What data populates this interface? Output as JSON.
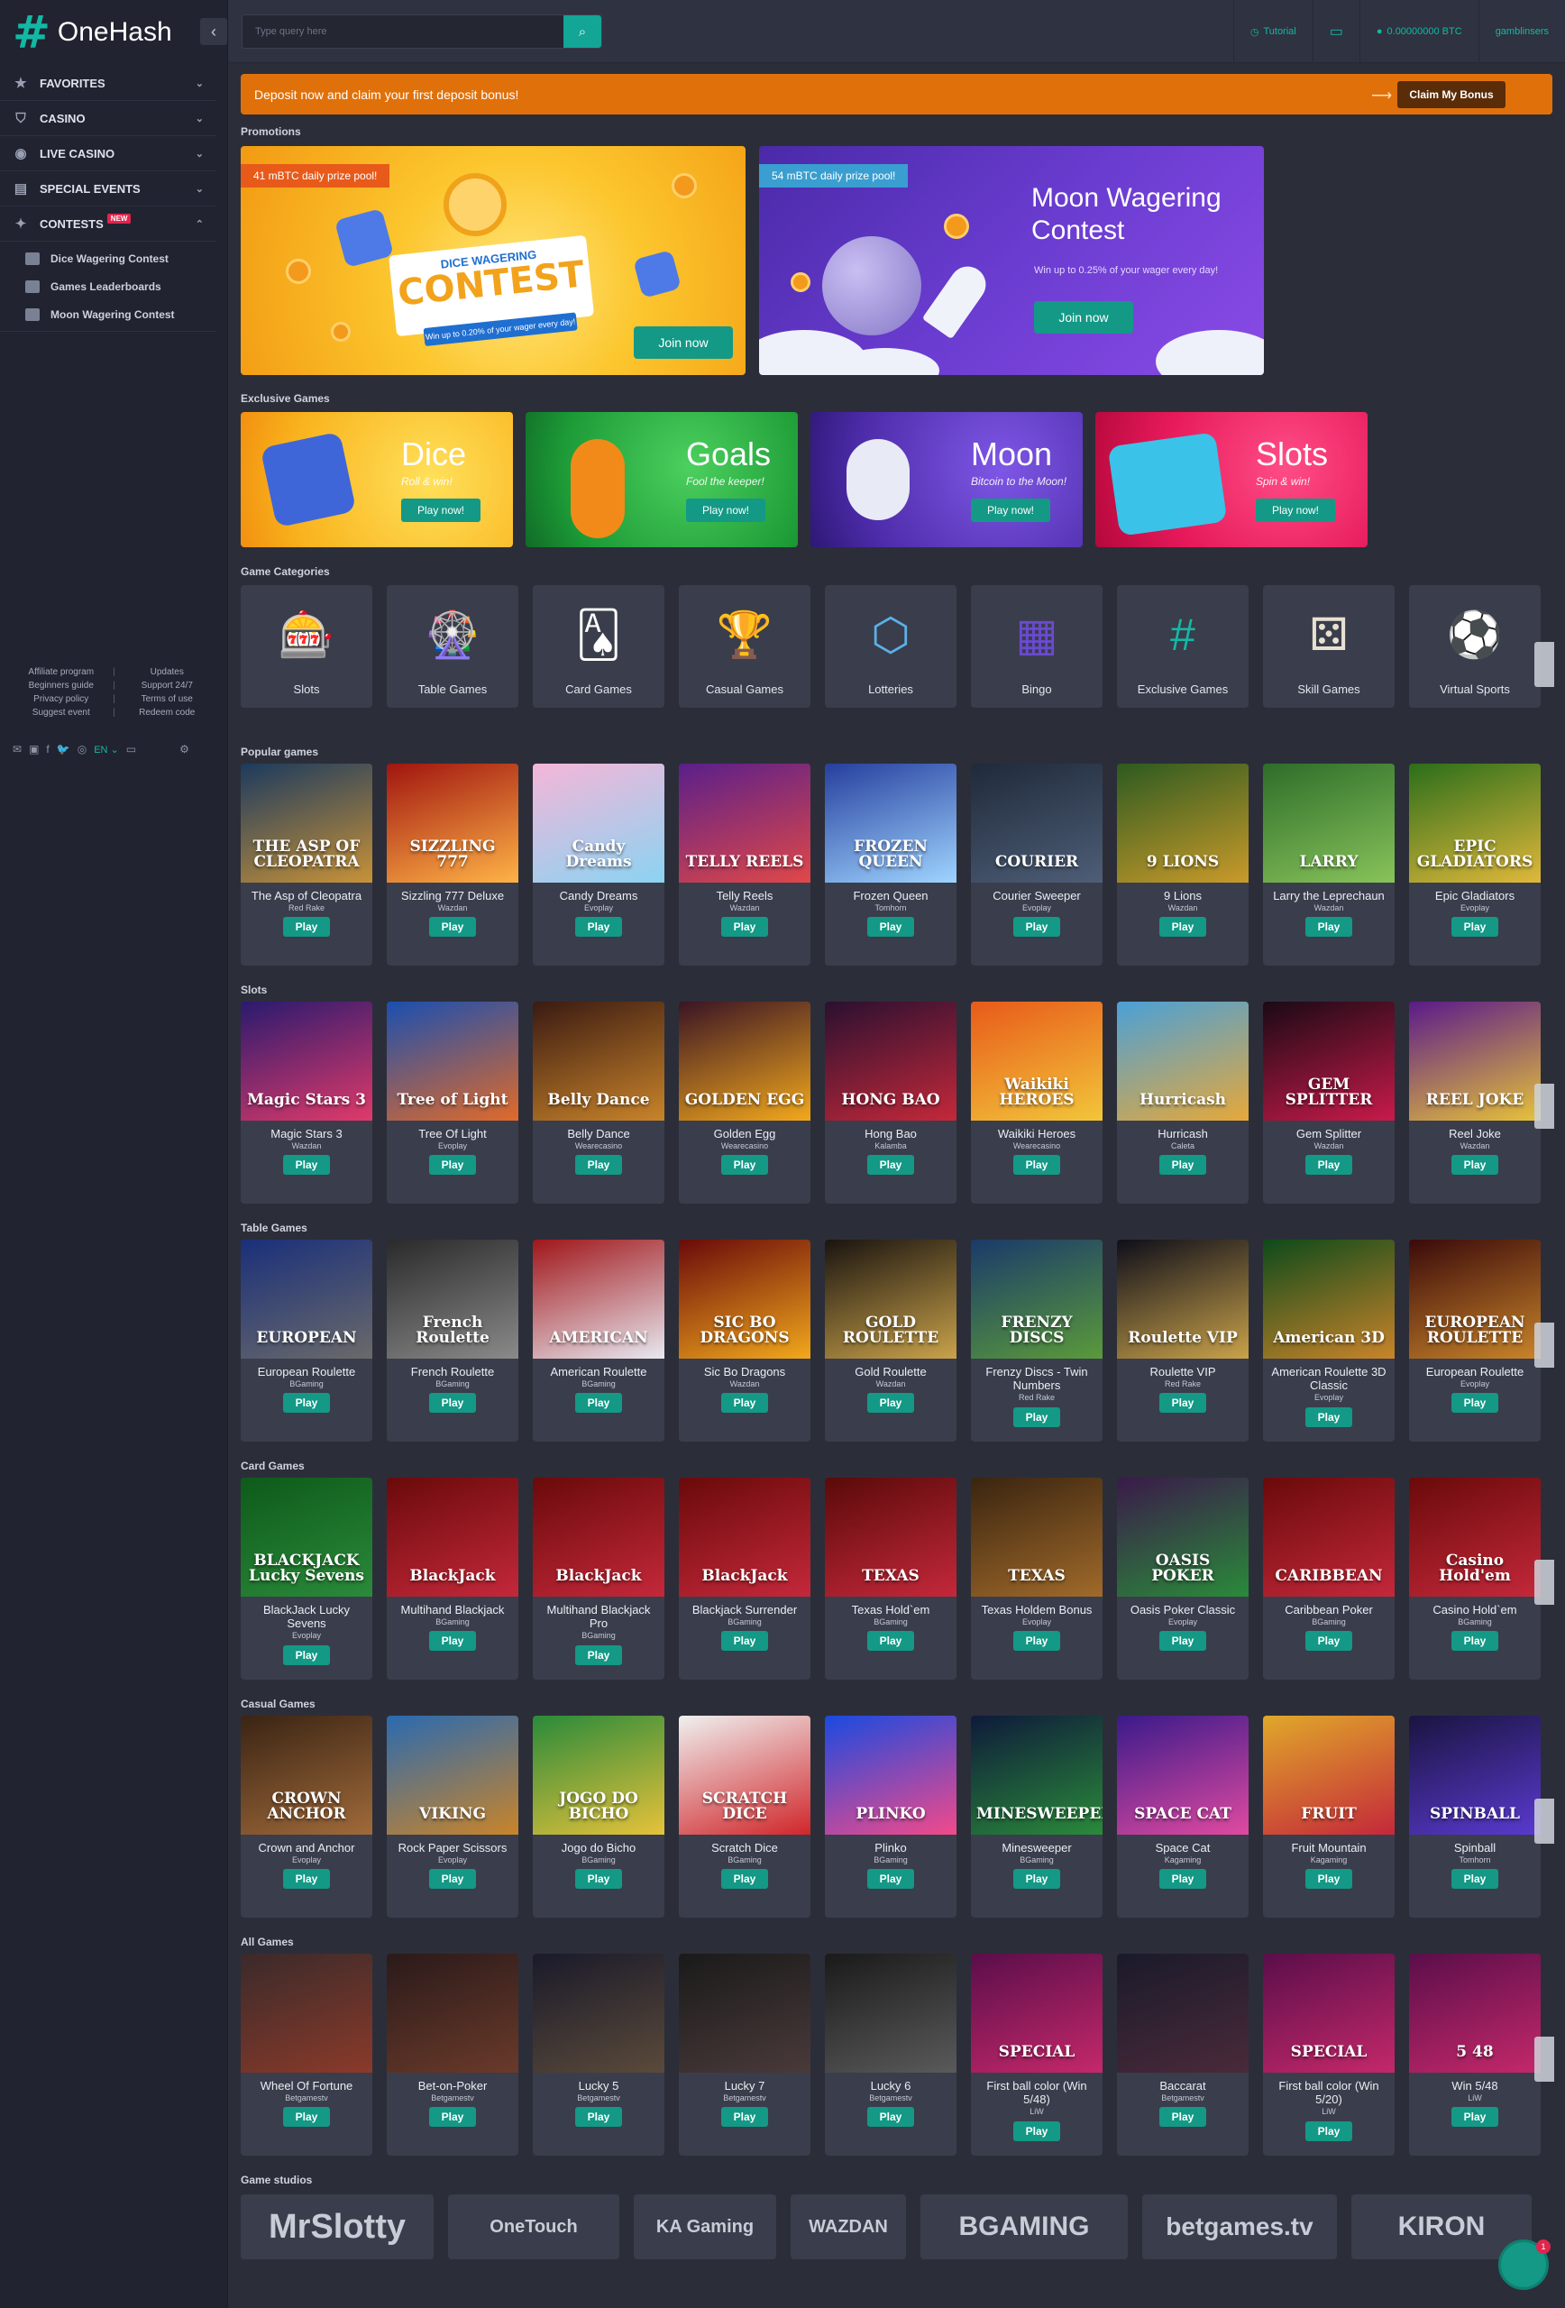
{
  "brand": {
    "name": "OneHash",
    "mark": "#",
    "accent": "#13b8a4"
  },
  "sidebar": {
    "items": [
      {
        "label": "FAVORITES",
        "icon": "star-icon"
      },
      {
        "label": "CASINO",
        "icon": "shield-icon"
      },
      {
        "label": "LIVE CASINO",
        "icon": "live-icon"
      },
      {
        "label": "SPECIAL EVENTS",
        "icon": "calendar-icon"
      },
      {
        "label": "CONTESTS",
        "icon": "sparkle-icon",
        "badge": "NEW"
      }
    ],
    "contests_sub": [
      "Dice Wagering Contest",
      "Games Leaderboards",
      "Moon Wagering Contest"
    ],
    "footer_links": [
      [
        "Affiliate program",
        "Updates"
      ],
      [
        "Beginners guide",
        "Support 24/7"
      ],
      [
        "Privacy policy",
        "Terms of use"
      ],
      [
        "Suggest event",
        "Redeem code"
      ]
    ],
    "language": "EN"
  },
  "topbar": {
    "search_placeholder": "Type query here",
    "tutorial": "Tutorial",
    "balance": "0.00000000 BTC",
    "username": "gamblinsers"
  },
  "bonus_bar": {
    "text": "Deposit now and claim your first deposit bonus!",
    "button": "Claim My Bonus"
  },
  "sections": {
    "promotions": "Promotions",
    "exclusive": "Exclusive Games",
    "categories": "Game Categories",
    "popular": "Popular games",
    "slots": "Slots",
    "table": "Table Games",
    "card": "Card Games",
    "casual": "Casual Games",
    "all": "All Games",
    "studios": "Game studios"
  },
  "promotions": [
    {
      "tag": "41 mBTC daily prize pool!",
      "title_small": "DICE WAGERING",
      "title_big": "CONTEST",
      "ribbon": "Win up to 0.20% of your wager every day!",
      "button": "Join now"
    },
    {
      "tag": "54 mBTC daily prize pool!",
      "title": "Moon Wagering Contest",
      "subtitle": "Win up to 0.25% of your wager every day!",
      "button": "Join now"
    }
  ],
  "exclusive_games": [
    {
      "title": "Dice",
      "subtitle": "Roll & win!",
      "button": "Play now!"
    },
    {
      "title": "Goals",
      "subtitle": "Fool the keeper!",
      "button": "Play now!"
    },
    {
      "title": "Moon",
      "subtitle": "Bitcoin to the Moon!",
      "button": "Play now!"
    },
    {
      "title": "Slots",
      "subtitle": "Spin & win!",
      "button": "Play now!"
    }
  ],
  "categories": [
    {
      "label": "Slots",
      "icon": "slot-machine-icon",
      "glyph": "🎰"
    },
    {
      "label": "Table Games",
      "icon": "roulette-icon",
      "glyph": "🎡"
    },
    {
      "label": "Card Games",
      "icon": "cards-icon",
      "glyph": "🂡"
    },
    {
      "label": "Casual Games",
      "icon": "trophy-icon",
      "glyph": "🏆"
    },
    {
      "label": "Lotteries",
      "icon": "lottery-icon",
      "glyph": "⬡"
    },
    {
      "label": "Bingo",
      "icon": "bingo-icon",
      "glyph": "▦"
    },
    {
      "label": "Exclusive Games",
      "icon": "hash-icon",
      "glyph": "#"
    },
    {
      "label": "Skill Games",
      "icon": "domino-icon",
      "glyph": "⚄"
    },
    {
      "label": "Virtual Sports",
      "icon": "soccer-ball-icon",
      "glyph": "⚽"
    }
  ],
  "play_label": "Play",
  "rows": {
    "popular": [
      {
        "name": "The Asp of Cleopatra",
        "provider": "Red Rake",
        "art": "THE ASP OF CLEOPATRA",
        "c1": "#1c3a5e",
        "c2": "#c79238"
      },
      {
        "name": "Sizzling 777 Deluxe",
        "provider": "Wazdan",
        "art": "SIZZLING 777",
        "c1": "#a0150f",
        "c2": "#ffb347"
      },
      {
        "name": "Candy Dreams",
        "provider": "Evoplay",
        "art": "Candy Dreams",
        "c1": "#f5b6d8",
        "c2": "#8bd3f2"
      },
      {
        "name": "Telly Reels",
        "provider": "Wazdan",
        "art": "TELLY REELS",
        "c1": "#5a1f8a",
        "c2": "#e04848"
      },
      {
        "name": "Frozen Queen",
        "provider": "Tomhorn",
        "art": "FROZEN QUEEN",
        "c1": "#263f9e",
        "c2": "#9fd4ff"
      },
      {
        "name": "Courier Sweeper",
        "provider": "Evoplay",
        "art": "COURIER",
        "c1": "#1f2a3a",
        "c2": "#4e5e77"
      },
      {
        "name": "9 Lions",
        "provider": "Wazdan",
        "art": "9 LIONS",
        "c1": "#2d5a20",
        "c2": "#c99a2a"
      },
      {
        "name": "Larry the Leprechaun",
        "provider": "Wazdan",
        "art": "LARRY",
        "c1": "#2e6d2a",
        "c2": "#88c35a"
      },
      {
        "name": "Epic Gladiators",
        "provider": "Evoplay",
        "art": "EPIC GLADIATORS",
        "c1": "#2b6e1a",
        "c2": "#e0b83a"
      }
    ],
    "slots": [
      {
        "name": "Magic Stars 3",
        "provider": "Wazdan",
        "art": "Magic Stars 3",
        "c1": "#2a1a6e",
        "c2": "#e03a6a"
      },
      {
        "name": "Tree Of Light",
        "provider": "Evoplay",
        "art": "Tree of Light",
        "c1": "#1a4fb0",
        "c2": "#e06a2a"
      },
      {
        "name": "Belly Dance",
        "provider": "Wearecasino",
        "art": "Belly Dance",
        "c1": "#3a1a12",
        "c2": "#c9842a"
      },
      {
        "name": "Golden Egg",
        "provider": "Wearecasino",
        "art": "GOLDEN EGG",
        "c1": "#3a1424",
        "c2": "#f2a81c"
      },
      {
        "name": "Hong Bao",
        "provider": "Kalamba",
        "art": "HONG BAO",
        "c1": "#2a1030",
        "c2": "#c4283a"
      },
      {
        "name": "Waikiki Heroes",
        "provider": "Wearecasino",
        "art": "Waikiki HEROES",
        "c1": "#e85a1a",
        "c2": "#f2c63a"
      },
      {
        "name": "Hurricash",
        "provider": "Caleta",
        "art": "Hurricash",
        "c1": "#4aa0d8",
        "c2": "#e6a83a"
      },
      {
        "name": "Gem Splitter",
        "provider": "Wazdan",
        "art": "GEM SPLITTER",
        "c1": "#1a0a14",
        "c2": "#c81a4a"
      },
      {
        "name": "Reel Joke",
        "provider": "Wazdan",
        "art": "REEL JOKE",
        "c1": "#5a1a8a",
        "c2": "#e6c23a"
      }
    ],
    "table": [
      {
        "name": "European Roulette",
        "provider": "BGaming",
        "art": "EUROPEAN",
        "c1": "#1a2f7a",
        "c2": "#6a6a6a"
      },
      {
        "name": "French Roulette",
        "provider": "BGaming",
        "art": "French Roulette",
        "c1": "#2a2a2a",
        "c2": "#8a8a8a"
      },
      {
        "name": "American Roulette",
        "provider": "BGaming",
        "art": "AMERICAN",
        "c1": "#a0161a",
        "c2": "#e8e8f0"
      },
      {
        "name": "Sic Bo Dragons",
        "provider": "Wazdan",
        "art": "SIC BO DRAGONS",
        "c1": "#6a0a0a",
        "c2": "#f2a81c"
      },
      {
        "name": "Gold Roulette",
        "provider": "Wazdan",
        "art": "GOLD ROULETTE",
        "c1": "#1a1410",
        "c2": "#c9a24a"
      },
      {
        "name": "Frenzy Discs - Twin Numbers",
        "provider": "Red Rake",
        "art": "FRENZY DISCS",
        "c1": "#1a3a6a",
        "c2": "#5a9a3a"
      },
      {
        "name": "Roulette VIP",
        "provider": "Red Rake",
        "art": "Roulette VIP",
        "c1": "#0e0e1a",
        "c2": "#c9a24a"
      },
      {
        "name": "American Roulette 3D Classic",
        "provider": "Evoplay",
        "art": "American 3D",
        "c1": "#0e4a1a",
        "c2": "#c9842a"
      },
      {
        "name": "European Roulette",
        "provider": "Evoplay",
        "art": "EUROPEAN ROULETTE",
        "c1": "#3a0a0a",
        "c2": "#c9842a"
      }
    ],
    "card": [
      {
        "name": "BlackJack Lucky Sevens",
        "provider": "Evoplay",
        "art": "BLACKJACK Lucky Sevens",
        "c1": "#0e5a1a",
        "c2": "#2a8a3a"
      },
      {
        "name": "Multihand Blackjack",
        "provider": "BGaming",
        "art": "BlackJack",
        "c1": "#6a0a0a",
        "c2": "#c4283a"
      },
      {
        "name": "Multihand Blackjack Pro",
        "provider": "BGaming",
        "art": "BlackJack",
        "c1": "#6a0a0a",
        "c2": "#c4283a"
      },
      {
        "name": "Blackjack Surrender",
        "provider": "BGaming",
        "art": "BlackJack",
        "c1": "#6a0a0a",
        "c2": "#c4283a"
      },
      {
        "name": "Texas Hold`em",
        "provider": "BGaming",
        "art": "TEXAS",
        "c1": "#5a0a0a",
        "c2": "#c4283a"
      },
      {
        "name": "Texas Holdem Bonus",
        "provider": "Evoplay",
        "art": "TEXAS",
        "c1": "#3a2410",
        "c2": "#a06a2a"
      },
      {
        "name": "Oasis Poker Classic",
        "provider": "Evoplay",
        "art": "OASIS POKER",
        "c1": "#3a1a4a",
        "c2": "#2a8a3a"
      },
      {
        "name": "Caribbean Poker",
        "provider": "BGaming",
        "art": "CARIBBEAN",
        "c1": "#6a0a0a",
        "c2": "#c4283a"
      },
      {
        "name": "Casino Hold`em",
        "provider": "BGaming",
        "art": "Casino Hold'em",
        "c1": "#6a0a0a",
        "c2": "#c4283a"
      }
    ],
    "casual": [
      {
        "name": "Crown and Anchor",
        "provider": "Evoplay",
        "art": "CROWN ANCHOR",
        "c1": "#3a2414",
        "c2": "#a06a3a"
      },
      {
        "name": "Rock Paper Scissors",
        "provider": "Evoplay",
        "art": "VIKING",
        "c1": "#2a6ab0",
        "c2": "#c9842a"
      },
      {
        "name": "Jogo do Bicho",
        "provider": "BGaming",
        "art": "JOGO DO BICHO",
        "c1": "#2a8a3a",
        "c2": "#e6c23a"
      },
      {
        "name": "Scratch Dice",
        "provider": "BGaming",
        "art": "SCRATCH DICE",
        "c1": "#f0f0f0",
        "c2": "#d0262a"
      },
      {
        "name": "Plinko",
        "provider": "BGaming",
        "art": "PLINKO",
        "c1": "#1a4ae0",
        "c2": "#f24a8a"
      },
      {
        "name": "Minesweeper",
        "provider": "BGaming",
        "art": "MINESWEEPER",
        "c1": "#0e1a3a",
        "c2": "#2a8a3a"
      },
      {
        "name": "Space Cat",
        "provider": "Kagaming",
        "art": "SPACE CAT",
        "c1": "#3a1a8a",
        "c2": "#e04aa0"
      },
      {
        "name": "Fruit Mountain",
        "provider": "Kagaming",
        "art": "FRUIT",
        "c1": "#e0a82a",
        "c2": "#c4283a"
      },
      {
        "name": "Spinball",
        "provider": "Tomhorn",
        "art": "SPINBALL",
        "c1": "#1a1440",
        "c2": "#5a3ad0"
      }
    ],
    "all": [
      {
        "name": "Wheel Of Fortune",
        "provider": "Betgamestv",
        "art": "",
        "c1": "#3a2a2a",
        "c2": "#8a3a2a"
      },
      {
        "name": "Bet-on-Poker",
        "provider": "Betgamestv",
        "art": "",
        "c1": "#2a1a1a",
        "c2": "#6a3a2a"
      },
      {
        "name": "Lucky 5",
        "provider": "Betgamestv",
        "art": "",
        "c1": "#1a1a2a",
        "c2": "#5a4a3a"
      },
      {
        "name": "Lucky 7",
        "provider": "Betgamestv",
        "art": "",
        "c1": "#1a1a1a",
        "c2": "#4a3a3a"
      },
      {
        "name": "Lucky 6",
        "provider": "Betgamestv",
        "art": "",
        "c1": "#1a1a1a",
        "c2": "#5a5a5a"
      },
      {
        "name": "First ball color (Win 5/48)",
        "provider": "LiW",
        "art": "SPECIAL",
        "c1": "#5a0e4a",
        "c2": "#c4286a"
      },
      {
        "name": "Baccarat",
        "provider": "Betgamestv",
        "art": "",
        "c1": "#1a1a2a",
        "c2": "#4a2a3a"
      },
      {
        "name": "First ball color (Win 5/20)",
        "provider": "LiW",
        "art": "SPECIAL",
        "c1": "#5a0e4a",
        "c2": "#c4286a"
      },
      {
        "name": "Win 5/48",
        "provider": "LiW",
        "art": "5 48",
        "c1": "#5a0e4a",
        "c2": "#c4286a"
      }
    ]
  },
  "studios": [
    "MrSlotty",
    "OneTouch",
    "KA Gaming",
    "WAZDAN",
    "BGAMING",
    "betgames.tv",
    "KIRON"
  ],
  "chat_badge": "1"
}
